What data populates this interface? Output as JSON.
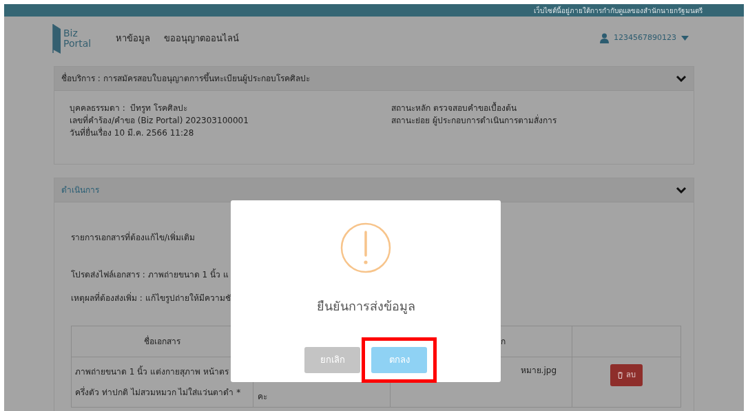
{
  "top_bar": {
    "notice": "เว็บไซต์นี้อยู่ภายใต้การกำกับดูแลของสำนักนายกรัฐมนตรี"
  },
  "header": {
    "logo": [
      "Biz",
      "Portal"
    ],
    "nav": [
      {
        "label": "หาข้อมูล"
      },
      {
        "label": "ขออนุญาตออนไลน์"
      }
    ],
    "user": "1234567890123"
  },
  "service_card": {
    "title": "ชื่อบริการ : การสมัครสอบใบอนุญาตการขึ้นทะเบียนผู้ประกอบโรคศิลปะ",
    "expanded": true,
    "left": [
      "บุคคลธรรมดา :  บีทรูท โรคศิลปะ",
      "เลขที่คำร้อง/คำขอ (Biz Portal) 202303100001",
      "วันที่ยื่นเรื่อง 10 มี.ค. 2566 11:28"
    ],
    "right": [
      "สถานะหลัก ตรวจสอบคำขอเบื้องต้น",
      "สถานะย่อย ผู้ประกอบการดำเนินการตามสั่งการ"
    ]
  },
  "action_card": {
    "title": "ดำเนินการ",
    "expanded": true,
    "heading": "รายการเอกสารที่ต้องแก้ไข/เพิ่มเติม",
    "lines": [
      "โปรดส่งไฟล์เอกสาร : ภาพถ่ายขนาด 1 นิ้ว แ",
      "เหตุผลที่ต้องส่งเพิ่ม : แก้ไขรูปถ่ายให้มีความชั"
    ],
    "table": {
      "columns": [
        "ชื่อเอกสาร",
        "ก"
      ],
      "rows": [
        {
          "column_1": [
            "ภาพถ่ายขนาด 1 นิ้ว แต่งกายสุภาพ หน้าตร",
            "ครึ่งตัว ท่าปกติ ไม่สวมหมวก ไม่ใส่แว่นตาดำ *"
          ],
          "column_2": "คะ",
          "column_3": "หมาย.jpg",
          "delete": "ลบ"
        }
      ]
    }
  },
  "dialog": {
    "message": "ยืนยันการส่งข้อมูล",
    "buttons": [
      {
        "label": "ยกเลิก",
        "kind": "cancel",
        "highlighted": false
      },
      {
        "label": "ตกลง",
        "kind": "confirm",
        "highlighted": true
      }
    ]
  }
}
